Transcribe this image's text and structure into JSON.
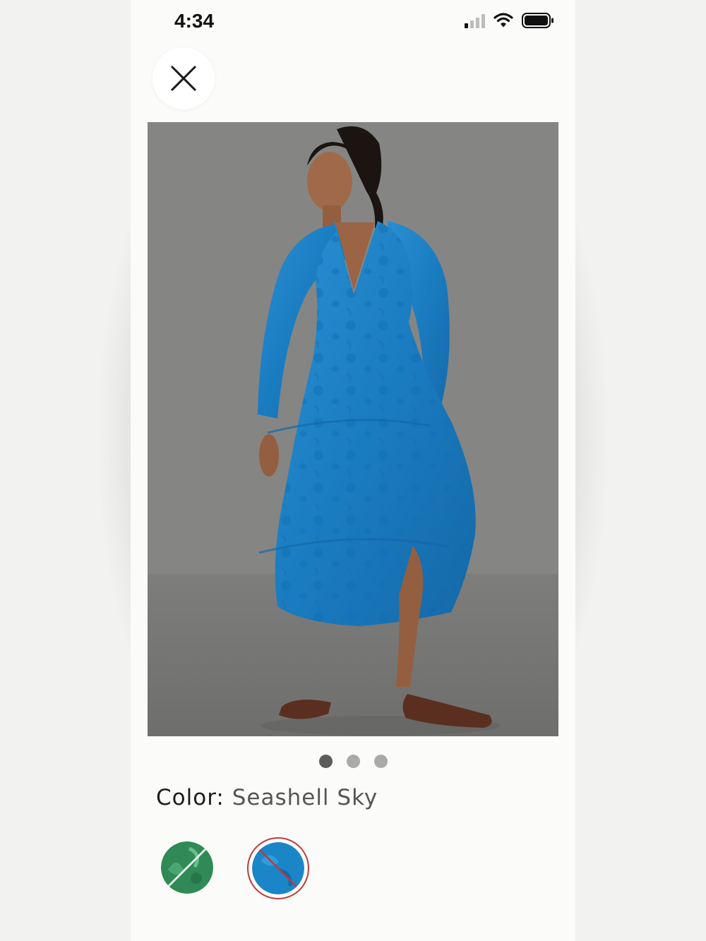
{
  "status_bar": {
    "time": "4:34",
    "icons": [
      "cellular-signal-icon",
      "wifi-icon",
      "battery-icon"
    ]
  },
  "close_icon": "close-icon",
  "gallery": {
    "image_description_icon": "product-photo",
    "image_count": 3,
    "active_index": 0
  },
  "color": {
    "label": "Color:",
    "selected": "Seashell Sky"
  },
  "swatches": [
    {
      "name": "green-swatch",
      "color": "#2f8a55",
      "selected": false,
      "unavailable": true
    },
    {
      "name": "blue-swatch",
      "color": "#1a86c8",
      "selected": true,
      "unavailable": true
    }
  ],
  "colors": {
    "dress_blue": "#1c7fc4",
    "backdrop_gray": "#858584",
    "selected_ring": "#c0393a"
  }
}
